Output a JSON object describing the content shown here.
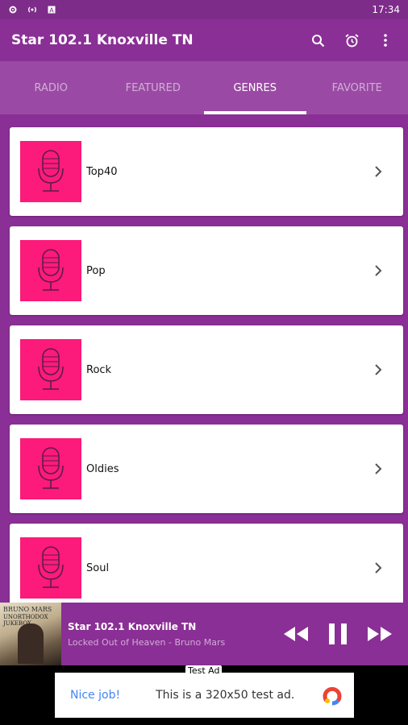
{
  "status_bar": {
    "time": "17:34"
  },
  "app_bar": {
    "title": "Star 102.1 Knoxville TN"
  },
  "tabs": [
    {
      "label": "RADIO",
      "active": false
    },
    {
      "label": "FEATURED",
      "active": false
    },
    {
      "label": "GENRES",
      "active": true
    },
    {
      "label": "FAVORITE",
      "active": false
    }
  ],
  "genres": [
    {
      "label": "Top40"
    },
    {
      "label": "Pop"
    },
    {
      "label": "Rock"
    },
    {
      "label": "Oldies"
    },
    {
      "label": "Soul"
    }
  ],
  "player": {
    "station": "Star 102.1 Knoxville TN",
    "track": "Locked Out of Heaven - Bruno Mars",
    "album_artist": "BRUNO MARS",
    "album_subtitle": "UNORTHODOX JUKEBOX"
  },
  "ad": {
    "tag": "Test Ad",
    "nice": "Nice job!",
    "message": "This is a 320x50 test ad."
  },
  "colors": {
    "primary": "#8a2f95",
    "tab_bar": "#9a4aa4",
    "thumb": "#fc1a7a"
  }
}
